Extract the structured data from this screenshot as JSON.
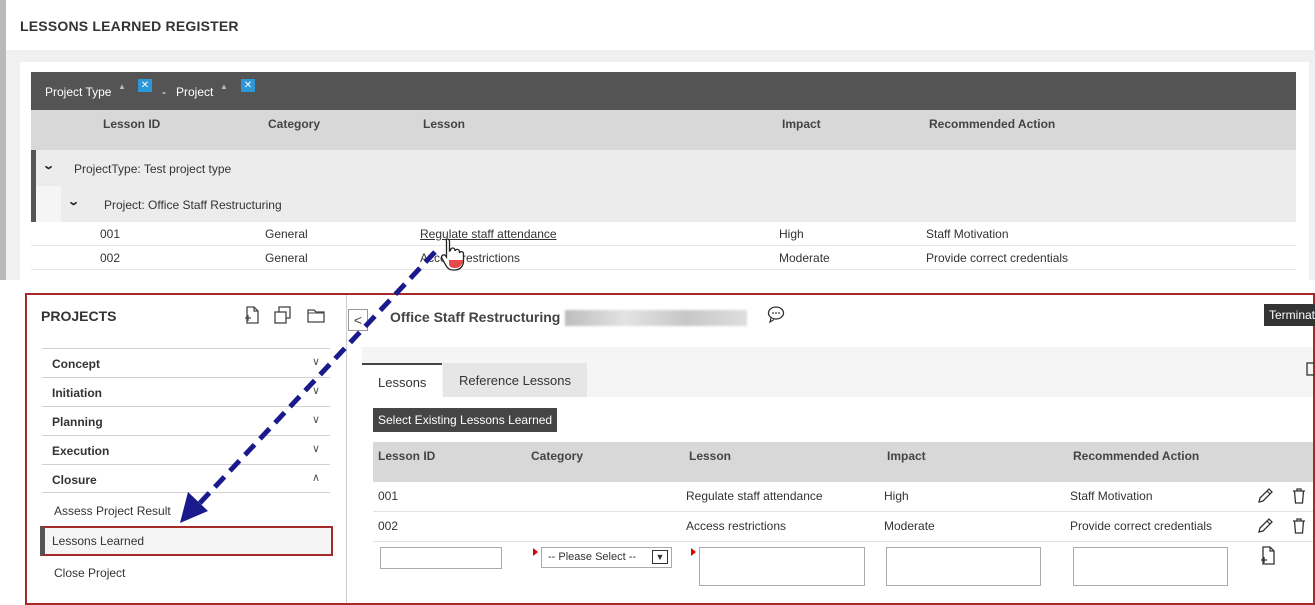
{
  "register": {
    "title": "LESSONS LEARNED REGISTER",
    "group_chips": [
      "Project Type",
      "Project"
    ],
    "group_remove": "✕",
    "group_sep": "-",
    "sort_glyph": "▲",
    "columns": [
      "Lesson ID",
      "Category",
      "Lesson",
      "Impact",
      "Recommended Action"
    ],
    "group1": "ProjectType: Test project type",
    "group2": "Project: Office Staff Restructuring",
    "rows": [
      {
        "id": "001",
        "category": "General",
        "lesson": "Regulate staff attendance",
        "impact": "High",
        "action": "Staff Motivation"
      },
      {
        "id": "002",
        "category": "General",
        "lesson": "Access restrictions",
        "impact": "Moderate",
        "action": "Provide correct credentials"
      }
    ]
  },
  "projects": {
    "title": "PROJECTS",
    "icons": [
      "new-document-icon",
      "duplicate-icon",
      "folder-icon"
    ],
    "sections": [
      {
        "label": "Concept",
        "chevron": "∨"
      },
      {
        "label": "Initiation",
        "chevron": "∨"
      },
      {
        "label": "Planning",
        "chevron": "∨"
      },
      {
        "label": "Execution",
        "chevron": "∨"
      },
      {
        "label": "Closure",
        "chevron": "∧"
      }
    ],
    "subitems": [
      "Assess Project Result",
      "Lessons Learned",
      "Close Project"
    ]
  },
  "detail": {
    "collapse_glyph": "<",
    "title": "Office Staff Restructuring",
    "terminate": "Terminate",
    "tabs": [
      "Lessons",
      "Reference Lessons"
    ],
    "select_button": "Select Existing Lessons Learned",
    "columns": [
      "Lesson ID",
      "Category",
      "Lesson",
      "Impact",
      "Recommended Action"
    ],
    "rows": [
      {
        "id": "001",
        "category": "",
        "lesson": "Regulate staff attendance",
        "impact": "High",
        "action": "Staff Motivation"
      },
      {
        "id": "002",
        "category": "",
        "lesson": "Access restrictions",
        "impact": "Moderate",
        "action": "Provide correct credentials"
      }
    ],
    "new_row": {
      "category_placeholder": "-- Please Select --",
      "select_arrow": "▼"
    }
  },
  "colors": {
    "annotation_red": "#a52a2a",
    "arrow_blue": "#1a1a8c",
    "dark_bar": "#545454",
    "chip_blue": "#2e97d8"
  }
}
